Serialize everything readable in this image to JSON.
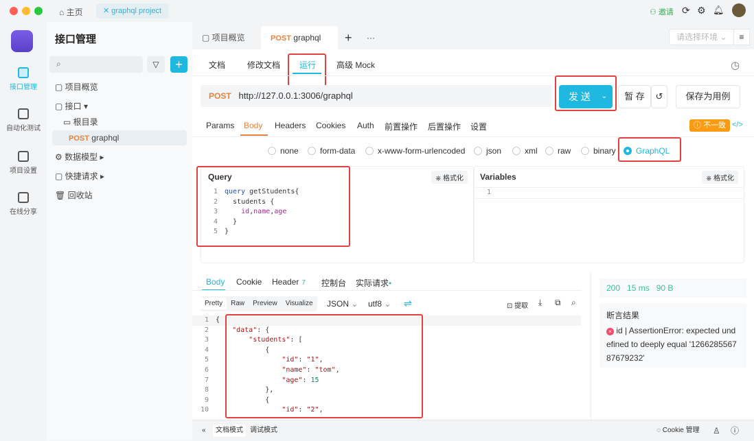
{
  "window": {
    "home_tab": "主页",
    "project_tab": "graphql project",
    "invite": "邀请"
  },
  "rail": [
    {
      "label": "接口管理",
      "active": true
    },
    {
      "label": "自动化测试"
    },
    {
      "label": "项目设置"
    },
    {
      "label": "在线分享"
    }
  ],
  "sidebar": {
    "title": "接口管理",
    "items": [
      "项目概览",
      "接口",
      "根目录",
      "graphql",
      "数据模型",
      "快捷请求",
      "回收站"
    ],
    "post": "POST"
  },
  "tabs": {
    "overview": "项目概览",
    "method": "POST",
    "current": "graphql",
    "env_placeholder": "请选择环境"
  },
  "subtabs": [
    "文档",
    "修改文档",
    "运行",
    "高级 Mock"
  ],
  "request": {
    "method": "POST",
    "url": "http://127.0.0.1:3006/graphql",
    "send": "发 送",
    "save": "暂 存",
    "save_case": "保存为用例"
  },
  "param_tabs": [
    "Params",
    "Body",
    "Headers",
    "Cookies",
    "Auth",
    "前置操作",
    "后置操作",
    "设置"
  ],
  "mismatch": "不一致",
  "body_types": [
    "none",
    "form-data",
    "x-www-form-urlencoded",
    "json",
    "xml",
    "raw",
    "binary",
    "GraphQL"
  ],
  "query": {
    "title": "Query",
    "format": "格式化",
    "lines": [
      [
        [
          "kw",
          "query"
        ],
        [
          "fn",
          " getStudents{"
        ]
      ],
      [
        [
          "fn",
          "  students {"
        ]
      ],
      [
        [
          "fld",
          "    id"
        ],
        [
          "fn",
          ","
        ],
        [
          "fld",
          "name"
        ],
        [
          "fn",
          ","
        ],
        [
          "fld",
          "age"
        ]
      ],
      [
        [
          "fn",
          "  }"
        ]
      ],
      [
        [
          "fn",
          "}"
        ]
      ]
    ]
  },
  "variables": {
    "title": "Variables",
    "format": "格式化",
    "lines": [
      [
        [
          "fn",
          ""
        ]
      ]
    ]
  },
  "response": {
    "tabs": [
      "Body",
      "Cookie",
      "Header",
      "控制台",
      "实际请求"
    ],
    "header_count": "7",
    "views": [
      "Pretty",
      "Raw",
      "Preview",
      "Visualize"
    ],
    "format": "JSON",
    "encoding": "utf8",
    "extract": "提取",
    "lines": [
      [
        [
          "fn",
          "{"
        ]
      ],
      [
        [
          "fn",
          "    "
        ],
        [
          "key",
          "\"data\""
        ],
        [
          "fn",
          ": {"
        ]
      ],
      [
        [
          "fn",
          "        "
        ],
        [
          "key",
          "\"students\""
        ],
        [
          "fn",
          ": ["
        ]
      ],
      [
        [
          "fn",
          "            {"
        ]
      ],
      [
        [
          "fn",
          "                "
        ],
        [
          "key",
          "\"id\""
        ],
        [
          "fn",
          ": "
        ],
        [
          "str",
          "\"1\""
        ],
        [
          "fn",
          ","
        ]
      ],
      [
        [
          "fn",
          "                "
        ],
        [
          "key",
          "\"name\""
        ],
        [
          "fn",
          ": "
        ],
        [
          "str",
          "\"tom\""
        ],
        [
          "fn",
          ","
        ]
      ],
      [
        [
          "fn",
          "                "
        ],
        [
          "key",
          "\"age\""
        ],
        [
          "fn",
          ": "
        ],
        [
          "num",
          "15"
        ]
      ],
      [
        [
          "fn",
          "            },"
        ]
      ],
      [
        [
          "fn",
          "            {"
        ]
      ],
      [
        [
          "fn",
          "                "
        ],
        [
          "key",
          "\"id\""
        ],
        [
          "fn",
          ": "
        ],
        [
          "str",
          "\"2\""
        ],
        [
          "fn",
          ","
        ]
      ]
    ]
  },
  "status": {
    "code": "200",
    "time": "15 ms",
    "size": "90 B",
    "assert_title": "断言结果",
    "assert_msg": "id | AssertionError: expected undefined to deeply equal '126628556787679232'"
  },
  "footer": {
    "doc_mode": "文档模式",
    "debug_mode": "调试模式",
    "cookie": "Cookie 管理"
  }
}
